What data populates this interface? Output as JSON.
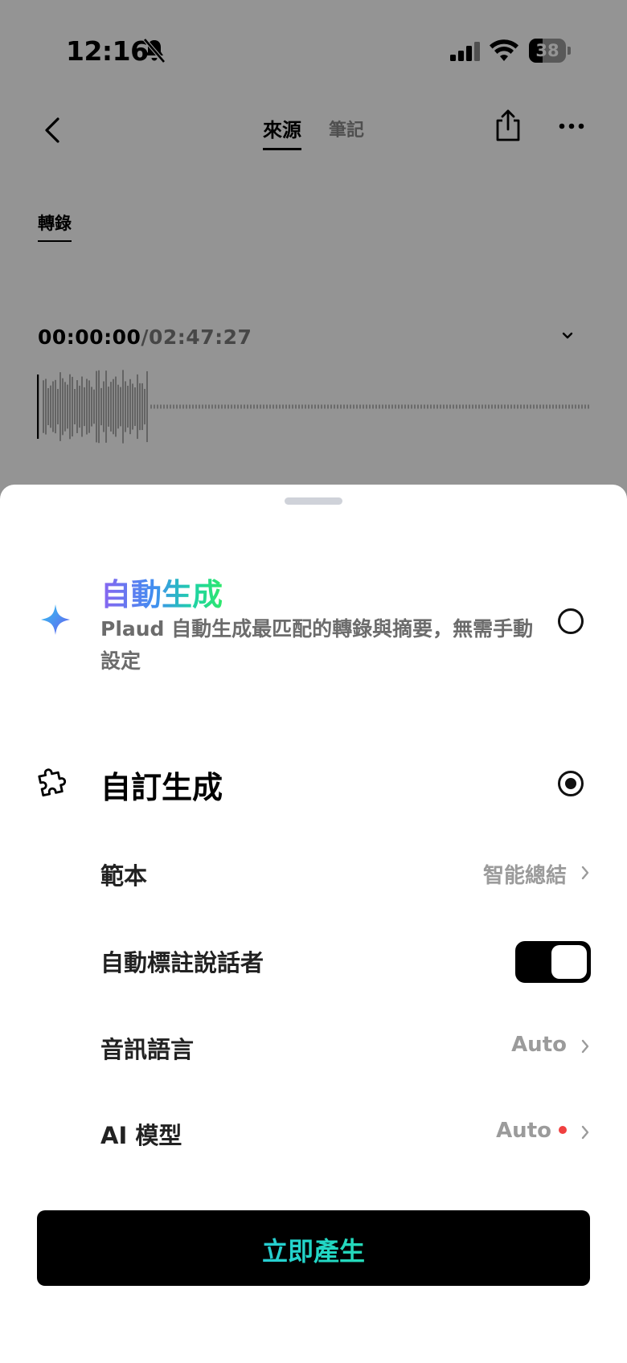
{
  "status_bar": {
    "time": "12:16",
    "battery_percent": "38",
    "battery_level": 0.38,
    "icons": [
      "bell-muted-icon",
      "cellular-signal-icon",
      "wifi-icon",
      "battery-icon"
    ]
  },
  "top_nav": {
    "tabs": [
      {
        "label": "來源",
        "active": true
      },
      {
        "label": "筆記",
        "active": false
      }
    ],
    "icons": [
      "back-icon",
      "share-icon",
      "more-icon"
    ]
  },
  "source": {
    "subtab": "轉錄",
    "current_time": "00:00:00",
    "separator": "/",
    "duration": "02:47:27",
    "playback_progress": 0
  },
  "sheet": {
    "auto": {
      "title": "自動生成",
      "description": "Plaud 自動生成最匹配的轉錄與摘要，無需手動設定",
      "selected": false,
      "icon": "sparkle-icon"
    },
    "custom": {
      "title": "自訂生成",
      "selected": true,
      "icon": "puzzle-icon"
    },
    "settings": {
      "template": {
        "label": "範本",
        "value": "智能總結"
      },
      "speaker": {
        "label": "自動標註說話者",
        "enabled": true
      },
      "language": {
        "label": "音訊語言",
        "value": "Auto"
      },
      "model": {
        "label": "AI 模型",
        "value": "Auto",
        "has_indicator": true
      }
    },
    "generate_label": "立即產生"
  },
  "colors": {
    "accent_gradient": [
      "#8a64f0",
      "#3f8ff0",
      "#2ee86a"
    ],
    "button_bg": "#000000",
    "indicator": "#f04040"
  }
}
